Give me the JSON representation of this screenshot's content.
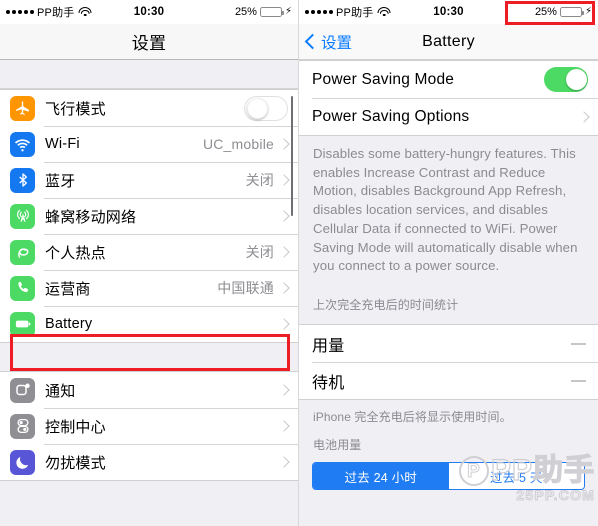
{
  "left": {
    "status_bar": {
      "signal_dots": 5,
      "carrier": "PP助手",
      "wifi_icon": "wifi-icon",
      "time": "10:30",
      "battery_percent": "25%",
      "battery_fill_color": "#4cd964",
      "battery_level": 30,
      "charging_bolt": "⚡"
    },
    "nav": {
      "title": "设置"
    },
    "groups": [
      {
        "rows": [
          {
            "icon": "airplane-icon",
            "icon_color": "#ff9500",
            "label": "飞行模式",
            "control": "toggle",
            "toggle_on": false
          },
          {
            "icon": "wifi-icon",
            "icon_color": "#1478f0",
            "label": "Wi-Fi",
            "value": "UC_mobile",
            "control": "chevron"
          },
          {
            "icon": "bluetooth-icon",
            "icon_color": "#1478f0",
            "label": "蓝牙",
            "value": "关闭",
            "control": "chevron"
          },
          {
            "icon": "cellular-tower-icon",
            "icon_color": "#4cd964",
            "label": "蜂窝移动网络",
            "value": "",
            "control": "chevron"
          },
          {
            "icon": "hotspot-icon",
            "icon_color": "#4cd964",
            "label": "个人热点",
            "value": "关闭",
            "control": "chevron"
          },
          {
            "icon": "phone-icon",
            "icon_color": "#4cd964",
            "label": "运营商",
            "value": "中国联通",
            "control": "chevron"
          },
          {
            "icon": "battery-icon",
            "icon_color": "#4cd964",
            "label": "Battery",
            "value": "",
            "control": "chevron",
            "highlighted": true
          }
        ]
      },
      {
        "rows": [
          {
            "icon": "notification-icon",
            "icon_color": "#8e8e93",
            "label": "通知",
            "value": "",
            "control": "chevron"
          },
          {
            "icon": "control-center-icon",
            "icon_color": "#8e8e93",
            "label": "控制中心",
            "value": "",
            "control": "chevron"
          },
          {
            "icon": "moon-icon",
            "icon_color": "#5856d6",
            "label": "勿扰模式",
            "value": "",
            "control": "chevron"
          }
        ]
      }
    ]
  },
  "right": {
    "status_bar": {
      "signal_dots": 5,
      "carrier": "PP助手",
      "wifi_icon": "wifi-icon",
      "time": "10:30",
      "battery_percent": "25%",
      "battery_fill_color": "#ffcc00",
      "battery_level": 30,
      "charging_bolt": "⚡"
    },
    "nav": {
      "back_label": "设置",
      "title": "Battery"
    },
    "rows": [
      {
        "label": "Power Saving Mode",
        "control": "toggle",
        "toggle_on": true
      },
      {
        "label": "Power Saving Options",
        "control": "chevron"
      }
    ],
    "description": "Disables some battery-hungry features. This enables Increase Contrast and Reduce Motion, disables Background App Refresh, disables location services, and disables Cellular Data if connected to WiFi. Power Saving Mode will automatically disable when you connect to a power source.",
    "usage_header": "上次完全充电后的时间统计",
    "usage_rows": [
      {
        "label": "用量",
        "value": "—"
      },
      {
        "label": "待机",
        "value": "—"
      }
    ],
    "usage_footnote": "iPhone 完全充电后将显示使用时间。",
    "battery_usage_header": "电池用量",
    "segmented": {
      "options": [
        {
          "label": "过去 24 小时",
          "selected": true
        },
        {
          "label": "过去 5 天",
          "selected": false
        }
      ]
    }
  },
  "watermark": {
    "logo_letter": "P",
    "text": "PP助手",
    "subtext": "25PP.COM"
  },
  "annotations": {
    "highlight_color": "#ee1c25",
    "boxes": [
      {
        "target": "battery-settings-row"
      },
      {
        "target": "status-bar-battery-indicator"
      }
    ]
  }
}
